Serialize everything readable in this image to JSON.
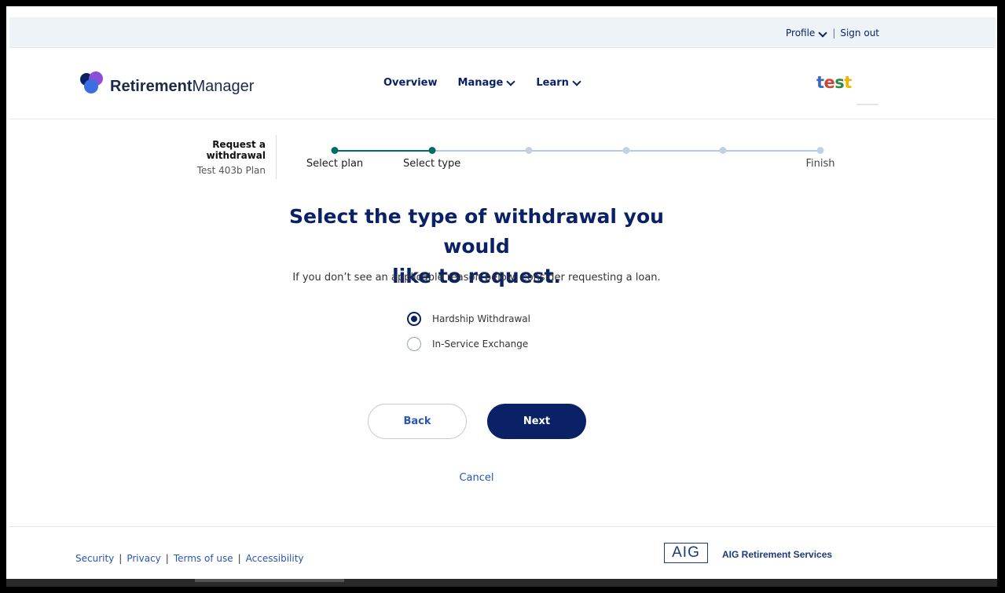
{
  "util": {
    "profile": "Profile",
    "sep": "|",
    "signout": "Sign out"
  },
  "brand": {
    "name_bold": "Retirement",
    "name_light": "Manager"
  },
  "nav": [
    {
      "label": "Overview"
    },
    {
      "label": "Manage"
    },
    {
      "label": "Learn"
    }
  ],
  "test_logo": {
    "letters": [
      "t",
      "e",
      "s",
      "t"
    ],
    "colors": [
      "#3b67c7",
      "#d04437",
      "#2c8a3e",
      "#f0b400"
    ]
  },
  "context": {
    "title": "Request a withdrawal",
    "plan": "Test 403b Plan"
  },
  "progress": {
    "steps": [
      {
        "label": "Select plan",
        "done": true
      },
      {
        "label": "Select type",
        "done": true
      },
      {
        "label": "",
        "done": false
      },
      {
        "label": "",
        "done": false
      },
      {
        "label": "",
        "done": false
      },
      {
        "label": "Finish",
        "done": false
      }
    ],
    "completed_fraction": 0.2
  },
  "main": {
    "heading_line1": "Select the type of withdrawal you would",
    "heading_line2": "like to request.",
    "subtext": "If you don’t see an applicable reason below, consider requesting a loan."
  },
  "options": [
    {
      "label": "Hardship Withdrawal",
      "checked": true
    },
    {
      "label": "In-Service Exchange",
      "checked": false
    }
  ],
  "buttons": {
    "back": "Back",
    "next": "Next",
    "cancel": "Cancel"
  },
  "footer": {
    "links": [
      "Security",
      "Privacy",
      "Terms of use",
      "Accessibility"
    ],
    "aig": "AIG",
    "aig_services": "AIG Retirement Services"
  },
  "colors": {
    "navy": "#0a2265",
    "teal": "#006d60",
    "link": "#2a55b0"
  }
}
